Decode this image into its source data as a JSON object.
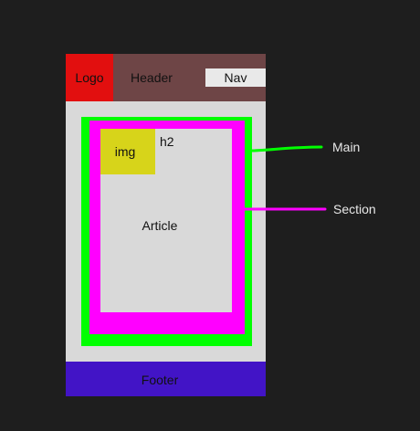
{
  "blocks": {
    "logo": "Logo",
    "header": "Header",
    "nav": "Nav",
    "img": "img",
    "h2": "h2",
    "article": "Article",
    "footer": "Footer"
  },
  "callouts": {
    "main": "Main",
    "section": "Section"
  },
  "colors": {
    "background": "#1e1e1e",
    "page": "#d9d9d9",
    "header": "#6e4546",
    "logo": "#e20f0f",
    "nav": "#e9e9e9",
    "main": "#00ff00",
    "section": "#ff00ff",
    "article": "#d9d9d9",
    "img": "#d7d41a",
    "footer": "#4214c6"
  }
}
